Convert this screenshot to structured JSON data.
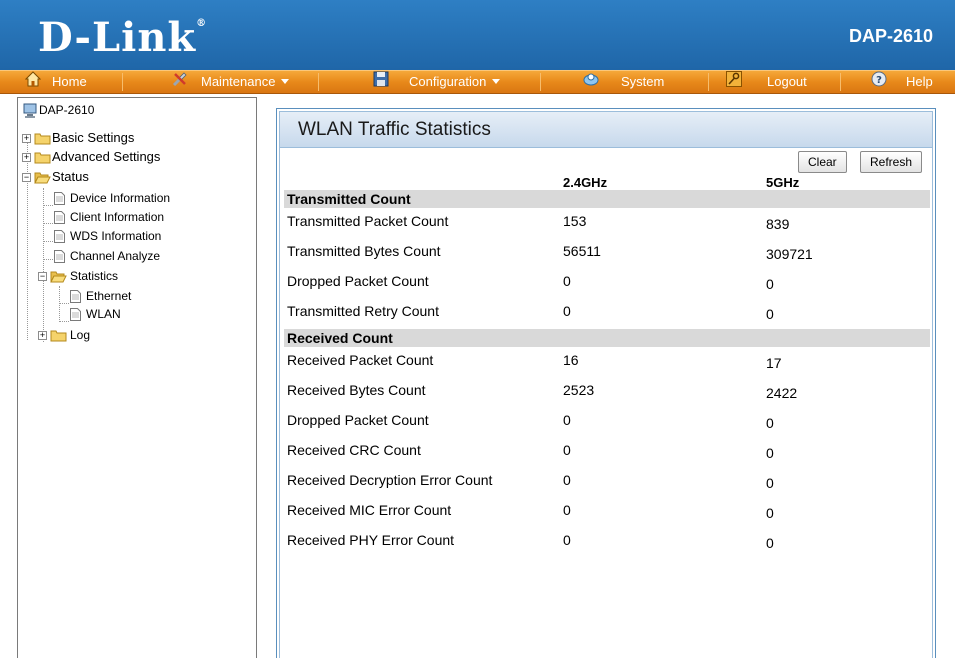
{
  "header": {
    "brand": "D-Link",
    "registered": "®",
    "model": "DAP-2610"
  },
  "menu": {
    "home": "Home",
    "maintenance": "Maintenance",
    "configuration": "Configuration",
    "system": "System",
    "logout": "Logout",
    "help": "Help"
  },
  "tree": {
    "root": "DAP-2610",
    "basic_settings": "Basic Settings",
    "advanced_settings": "Advanced Settings",
    "status": "Status",
    "device_information": "Device Information",
    "client_information": "Client Information",
    "wds_information": "WDS Information",
    "channel_analyze": "Channel Analyze",
    "statistics": "Statistics",
    "ethernet": "Ethernet",
    "wlan": "WLAN",
    "log": "Log"
  },
  "panel": {
    "title": "WLAN Traffic Statistics",
    "clear_label": "Clear",
    "refresh_label": "Refresh",
    "col_24": "2.4GHz",
    "col_5": "5GHz"
  },
  "transmitted": {
    "heading": "Transmitted Count",
    "rows": [
      {
        "label": "Transmitted Packet Count",
        "v24": "153",
        "v5": "839"
      },
      {
        "label": "Transmitted Bytes Count",
        "v24": "56511",
        "v5": "309721"
      },
      {
        "label": "Dropped Packet Count",
        "v24": "0",
        "v5": "0"
      },
      {
        "label": "Transmitted Retry Count",
        "v24": "0",
        "v5": "0"
      }
    ]
  },
  "received": {
    "heading": "Received Count",
    "rows": [
      {
        "label": "Received Packet Count",
        "v24": "16",
        "v5": "17"
      },
      {
        "label": "Received Bytes Count",
        "v24": "2523",
        "v5": "2422"
      },
      {
        "label": "Dropped Packet Count",
        "v24": "0",
        "v5": "0"
      },
      {
        "label": "Received CRC Count",
        "v24": "0",
        "v5": "0"
      },
      {
        "label": "Received Decryption Error Count",
        "v24": "0",
        "v5": "0"
      },
      {
        "label": "Received MIC Error Count",
        "v24": "0",
        "v5": "0"
      },
      {
        "label": "Received PHY Error Count",
        "v24": "0",
        "v5": "0"
      }
    ]
  },
  "colors": {
    "header_blue": "#2a73b6",
    "menu_orange": "#e8891a",
    "section_gray": "#d9d9d9"
  }
}
